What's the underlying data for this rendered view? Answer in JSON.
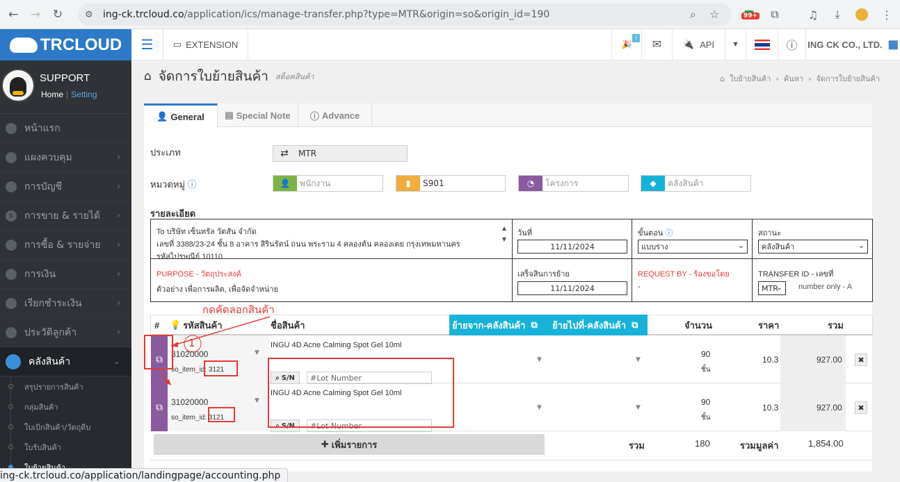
{
  "browser": {
    "url_host": "ing-ck.trcloud.co",
    "url_path": "/application/ics/manage-transfer.php?type=MTR&origin=so&origin_id=190",
    "ext_badge": "99+"
  },
  "header": {
    "logo_text": "TRCLOUD",
    "extension_label": "EXTENSION",
    "api_label": "API",
    "company": "ING CK CO., LTD.",
    "notif_badge": "!"
  },
  "sidebar": {
    "profile_name": "SUPPORT",
    "home_link": "Home",
    "setting_link": "Setting",
    "items": [
      {
        "label": "หน้าแรก"
      },
      {
        "label": "แผงควบคุม"
      },
      {
        "label": "การบัญชี"
      },
      {
        "label": "การขาย & รายได้"
      },
      {
        "label": "การซื้อ & รายจ่าย"
      },
      {
        "label": "การเงิน"
      },
      {
        "label": "เรียกชำระเงิน"
      },
      {
        "label": "ประวัติลูกค้า"
      },
      {
        "label": "คลังสินค้า"
      }
    ],
    "subitems": [
      {
        "label": "สรุปรายการสินค้า"
      },
      {
        "label": "กลุ่มสินค้า"
      },
      {
        "label": "ใบเบิกสินค้า/วัตถุดิบ"
      },
      {
        "label": "ใบรับสินค้า"
      },
      {
        "label": "ใบย้ายสินค้า"
      }
    ]
  },
  "page": {
    "title": "จัดการใบย้ายสินค้า",
    "subtitle": "สต็อคสินค้า",
    "breadcrumb": [
      "ใบย้ายสินค้า",
      "ค้นหา",
      "จัดการใบย้ายสินค้า"
    ]
  },
  "tabs": [
    {
      "label": "General"
    },
    {
      "label": "Special Note"
    },
    {
      "label": "Advance"
    }
  ],
  "form": {
    "type_label": "ประเภท",
    "type_value": "MTR",
    "category_label": "หมวดหมู่",
    "employee_placeholder": "พนักงาน",
    "doc_value": "S901",
    "project_placeholder": "โครงการ",
    "warehouse_placeholder": "คลังสินค้า",
    "detail_label": "รายละเอียด",
    "address_line1": "To บริษัท เซ็นทรัล วัตสัน จำกัด",
    "address_line2": "เลขที่ 3388/23-24 ชั้น 8 อาคาร สิรินรัตน์ ถนน พระราม 4 คลองตัน คลองเตย กรุงเทพมหานคร",
    "address_line3": "รหัสไปรษณีย์ 10110",
    "date_label": "วันที่",
    "date_value": "11/11/2024",
    "step_label": "ขั้นตอน",
    "step_value": "แบบร่าง",
    "status_label": "สถานะ",
    "status_value": "คลังสินค้า",
    "purpose_label": "PURPOSE - วัตถุประสงค์",
    "purpose_value": "ตัวอย่าง เพื่อการผลิต, เพื่อจัดจำหน่าย",
    "done_label": "เสร็จสินการย้าย",
    "done_value": "11/11/2024",
    "request_label": "REQUEST BY - ร้องขอโดย",
    "request_value": "-",
    "transfer_label": "TRANSFER ID - เลขที่",
    "transfer_select": "MTR",
    "transfer_hint": "number only - A"
  },
  "items_table": {
    "headers": {
      "num": "#",
      "code": "รหัสสินค้า",
      "name": "ชื่อสินค้า",
      "from": "ย้ายจาก-คลังสินค้า",
      "to": "ย้ายไปที่-คลังสินค้า",
      "qty": "จำนวน",
      "price": "ราคา",
      "total": "รวม"
    },
    "rows": [
      {
        "code": "31020000",
        "so_item_label": "so_item_id:",
        "so_item_id": "3121",
        "name": "INGU 4D Acne Calming Spot Gel 10ml",
        "sn_label": "S/N",
        "lot_placeholder": "#Lot Number",
        "qty": "90",
        "unit": "ชิ้น",
        "price": "10.3",
        "total": "927.00"
      },
      {
        "code": "31020000",
        "so_item_label": "so_item_id:",
        "so_item_id": "3121",
        "name": "INGU 4D Acne Calming Spot Gel 10ml",
        "sn_label": "S/N",
        "lot_placeholder": "#Lot Number",
        "qty": "90",
        "unit": "ชิ้น",
        "price": "10.3",
        "total": "927.00"
      }
    ],
    "add_label": "เพิ่มรายการ",
    "sum_label": "รวม",
    "sum_qty": "180",
    "sum_value_label": "รวมมูลค่า",
    "sum_value": "1,854.00"
  },
  "annotation": {
    "copy_hint": "กดคัดลอกสินค้า",
    "step_number": "1"
  },
  "status_url": "ing-ck.trcloud.co/application/landingpage/accounting.php",
  "colors": {
    "brand": "#2d79c7",
    "sidebar": "#2f3338",
    "purple": "#8a5a9e",
    "cyan": "#17b2d9",
    "annot": "#e53935"
  }
}
